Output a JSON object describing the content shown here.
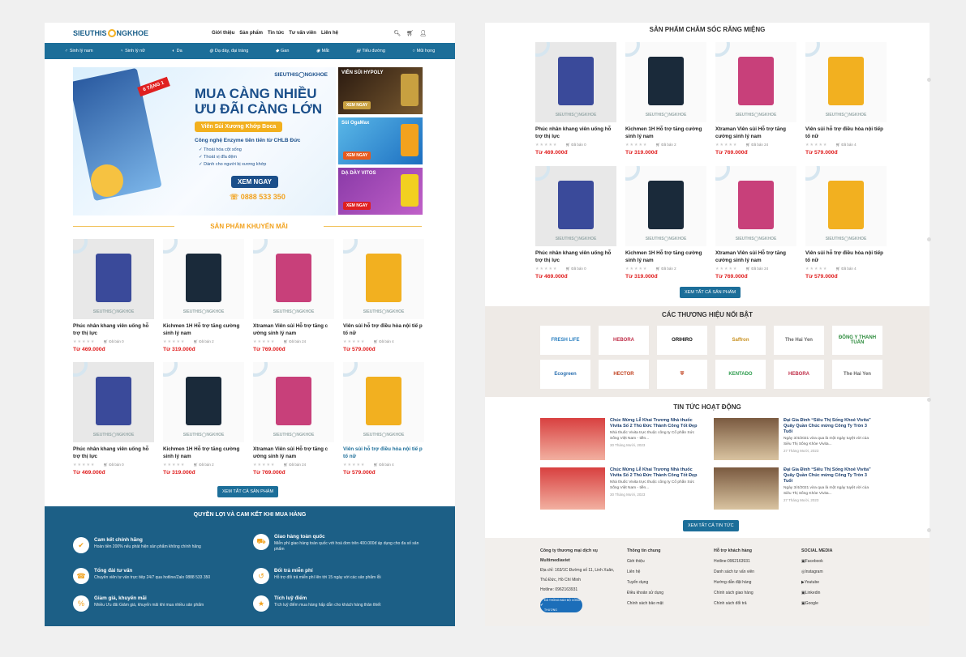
{
  "site": {
    "logo_left": "SIEUTHIS",
    "logo_right": "NGKHOE",
    "logo_sub": ".com"
  },
  "nav": {
    "items": [
      "Giới thiệu",
      "Sản phẩm",
      "Tin tức",
      "Tư vấn viên",
      "Liên hệ"
    ]
  },
  "categories": [
    {
      "icon": "man-icon",
      "label": "Sinh lý nam"
    },
    {
      "icon": "woman-icon",
      "label": "Sinh lý nữ"
    },
    {
      "icon": "skin-icon",
      "label": "Da"
    },
    {
      "icon": "stomach-icon",
      "label": "Dạ dày, đại tràng"
    },
    {
      "icon": "liver-icon",
      "label": "Gan"
    },
    {
      "icon": "eye-icon",
      "label": "Mắt"
    },
    {
      "icon": "diabetes-icon",
      "label": "Tiểu đường"
    },
    {
      "icon": "throat-icon",
      "label": "Mũi họng"
    }
  ],
  "banner": {
    "brand": "BOCA",
    "tag": "6 TẶNG 1",
    "logo": "SIEUTHIS◯NGKHOE",
    "line1": "MUA CÀNG NHIỀU",
    "line2": "ƯU ĐÃI CÀNG LỚN",
    "pill": "Viên Sủi Xương Khớp Boca",
    "tech": "Công nghệ Enzyme tiên tiến từ CHLB Đức",
    "bullets": [
      "✓ Thoái hóa cột sống",
      "✓ Thoát vị đĩa đệm",
      "✓ Dành cho người bị xương khớp"
    ],
    "cta": "XEM NGAY",
    "phone": "0888 533 350"
  },
  "side_banners": [
    {
      "title": "VIÊN SỦI HYPOLY",
      "cta": "XEM NGAY"
    },
    {
      "title": "Sủi OgaMax",
      "cta": "XEM NGAY"
    },
    {
      "title": "DẠ DÀY VITOS",
      "cta": "XEM NGAY"
    }
  ],
  "promo": {
    "title": "SẢN PHẨM KHUYẾN MÃI"
  },
  "products_left": [
    {
      "name": "Phúc nhân khang viên uống hỗ trợ thị lực",
      "sold": "Đã bán 0",
      "price": "Từ 469.000đ"
    },
    {
      "name": "Kichmen 1H Hỗ trợ tăng cường sinh lý nam",
      "sold": "Đã bán 2",
      "price": "Từ 319.000đ"
    },
    {
      "name": "Xtraman Viên sủi Hỗ trợ tăng c ường sinh lý nam",
      "sold": "Đã bán 24",
      "price": "Từ 769.000đ"
    },
    {
      "name": "Viên sủi hỗ trợ điều hòa nội tiế p tố nữ",
      "sold": "Đã bán 4",
      "price": "Từ 579.000đ"
    },
    {
      "name": "Phúc nhân khang viên uống hỗ trợ thị lực",
      "sold": "Đã bán 0",
      "price": "Từ 469.000đ"
    },
    {
      "name": "Kichmen 1H Hỗ trợ tăng cường sinh lý nam",
      "sold": "Đã bán 2",
      "price": "Từ 319.000đ"
    },
    {
      "name": "Xtraman Viên sủi Hỗ trợ tăng c ường sinh lý nam",
      "sold": "Đã bán 24",
      "price": "Từ 769.000đ"
    },
    {
      "name": "Viên sủi hỗ trợ điều hòa nội tiế p tố nữ",
      "sold": "Đã bán 4",
      "price": "Từ 579.000đ"
    }
  ],
  "stars": "★★★★★",
  "watermark": "SIEUTHIS◯NGKHOE",
  "btn_all_products": "XEM TẤT CẢ SẢN PHẨM",
  "benefits": {
    "title": "QUYỀN LỢI VÀ CAM KẾT KHI MUA HÀNG",
    "items": [
      {
        "title": "Cam kết chính hãng",
        "desc": "Hoàn tiền 200% nếu phát hiện sản phẩm không chính hãng"
      },
      {
        "title": "Giao hàng toàn quốc",
        "desc": "Miễn phí giao hàng toàn quốc với hoá đơn trên 400.000đ áp dụng cho đa số sản phẩm"
      },
      {
        "title": "Tổng đài tư vấn",
        "desc": "Chuyên viên tư vấn trực tiếp 24/7 qua hotline/Zalo 0888 533 350"
      },
      {
        "title": "Đổi trả miễn phí",
        "desc": "Hỗ trợ đổi trả miễn phí lên tới 15 ngày với các sản phẩm lỗi"
      },
      {
        "title": "Giảm giá, khuyến mãi",
        "desc": "Nhiều Ưu đãi Giảm giá, khuyến mãi khi mua nhiều sản phẩm"
      },
      {
        "title": "Tích luỹ điểm",
        "desc": "Tích luỹ điểm mua hàng hấp dẫn cho khách hàng thân thiết"
      }
    ]
  },
  "oral": {
    "title": "SẢN PHẨM CHĂM SÓC RĂNG MIỆNG"
  },
  "products_right": [
    {
      "name": "Phúc nhân khang viên uống hỗ trợ thị lực",
      "sold": "Đã bán 0",
      "price": "Từ 469.000đ"
    },
    {
      "name": "Kichmen 1H Hỗ trợ tăng cường sinh lý nam",
      "sold": "Đã bán 2",
      "price": "Từ 319.000đ"
    },
    {
      "name": "Xtraman Viên sủi Hỗ trợ tăng cường sinh lý nam",
      "sold": "Đã bán 24",
      "price": "Từ 769.000đ"
    },
    {
      "name": "Viên sủi hỗ trợ điều hòa nội tiếp tố nữ",
      "sold": "Đã bán 4",
      "price": "Từ 579.000đ"
    },
    {
      "name": "Phúc nhân khang viên uống hỗ trợ thị lực",
      "sold": "Đã bán 0",
      "price": "Từ 469.000đ"
    },
    {
      "name": "Kichmen 1H Hỗ trợ tăng cường sinh lý nam",
      "sold": "Đã bán 2",
      "price": "Từ 319.000đ"
    },
    {
      "name": "Xtraman Viên sủi Hỗ trợ tăng cường sinh lý nam",
      "sold": "Đã bán 24",
      "price": "Từ 769.000đ"
    },
    {
      "name": "Viên sủi hỗ trợ điều hòa nội tiếp tố nữ",
      "sold": "Đã bán 4",
      "price": "Từ 579.000đ"
    }
  ],
  "brands": {
    "title": "CÁC THƯƠNG HIỆU NỔI BẬT",
    "items": [
      {
        "name": "FRESH LIFE",
        "color": "#2a7fc0"
      },
      {
        "name": "HEBORA",
        "color": "#c0304a"
      },
      {
        "name": "ORIHIRO",
        "color": "#111111"
      },
      {
        "name": "Saffron",
        "color": "#c8901e"
      },
      {
        "name": "The Hai Yen",
        "color": "#666666"
      },
      {
        "name": "ĐÔNG Y THANH TUẤN",
        "color": "#2a8a3a"
      },
      {
        "name": "Ecogreen",
        "color": "#2a6fb0"
      },
      {
        "name": "HECTOR",
        "color": "#c0401e"
      },
      {
        "name": "⛨",
        "color": "#c0401e"
      },
      {
        "name": "KENTADO",
        "color": "#2a9a4a"
      },
      {
        "name": "HEBORA",
        "color": "#c0304a"
      },
      {
        "name": "The Hai Yen",
        "color": "#666666"
      }
    ]
  },
  "news": {
    "title": "TIN TỨC HOẠT ĐỘNG",
    "items": [
      {
        "title": "Chúc Mừng Lễ Khai Trương Nhà thuốc Vivita Số 2 Thủ Đức Thành Công Tốt Đẹp",
        "desc": "Nhà thuốc Vivita trực thuộc công ty Cổ phần Sức Sống Việt Nam - tiền...",
        "date": "30 Tháng Mười, 2023"
      },
      {
        "title": "Đại Gia Đình “Siêu Thị Sống Khoẻ Vivita” Quây Quần Chúc mừng Công Ty Tròn 3 Tuổi",
        "desc": "Ngày 3/4/2021 vừa qua là một ngày tuyệt vời của Siêu Thị Sống Khỏe Vivita...",
        "date": "27 Tháng Mười, 2023"
      },
      {
        "title": "Chúc Mừng Lễ Khai Trương Nhà thuốc Vivita Số 2 Thủ Đức Thành Công Tốt Đẹp",
        "desc": "Nhà thuốc Vivita trực thuộc công ty Cổ phần Sức Sống Việt Nam - tiền...",
        "date": "30 Tháng Mười, 2023"
      },
      {
        "title": "Đại Gia Đình “Siêu Thị Sống Khoẻ Vivita” Quây Quần Chúc mừng Công Ty Tròn 3 Tuổi",
        "desc": "Ngày 3/4/2021 vừa qua là một ngày tuyệt vời của Siêu Thị Sống Khỏe Vivita...",
        "date": "27 Tháng Mười, 2023"
      }
    ]
  },
  "btn_all_news": "XEM TẤT CẢ TIN TỨC",
  "footer": {
    "company": {
      "title": "Công ty thương mại dịch vụ",
      "name": "Multimediaviet",
      "address": "Địa chỉ: 163/1C Đường số 11, Linh Xuân, Thủ Đức, Hồ Chí Minh",
      "hotline": "Hotline: 0962163931",
      "badge": "ĐÃ THÔNG BÁO BỘ CÔNG THƯƠNG"
    },
    "info": {
      "title": "Thông tin chung",
      "links": [
        "Giới thiệu",
        "Liên hệ",
        "Tuyển dụng",
        "Điều khoản sử dụng",
        "Chính sách bảo mật"
      ]
    },
    "support": {
      "title": "Hỗ trợ khách hàng",
      "links": [
        "Hotline:0962163931",
        "Danh sách tư vấn viên",
        "Hướng dẫn đặt hàng",
        "Chính sách giao hàng",
        "Chính sách đổi trả"
      ]
    },
    "social": {
      "title": "SOCIAL MEDIA",
      "links": [
        "Facebook",
        "Instagram",
        "Youtube",
        "Linkedin",
        "Google"
      ]
    }
  },
  "colors": {
    "primary": "#1c6e99",
    "price": "#e02020",
    "accent": "#f2a21e"
  }
}
